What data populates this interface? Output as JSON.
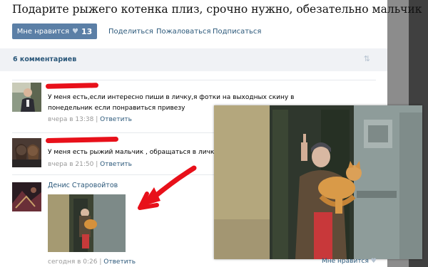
{
  "post": {
    "title": "Подарите рыжего котенка плиз, срочно нужно, обезательно мальчик",
    "like_label": "Мне нравится",
    "like_count": "13",
    "actions": [
      "Поделиться",
      "Пожаловаться",
      "Подписаться"
    ]
  },
  "comments_header": {
    "count_label": "6 комментариев",
    "sort_icon": "sort-arrows-icon"
  },
  "comments": [
    {
      "text": "У меня есть,если интересно пиши в личку,я фотки на выходных скину в понедельник если понравиться привезу",
      "time": "вчера в 13:38",
      "separator": "|",
      "reply": "Ответить"
    },
    {
      "text": "У меня есть рыжий мальчик , обращаться в личку.",
      "time": "вчера в 21:50",
      "separator": "|",
      "reply": "Ответить"
    },
    {
      "author": "Денис Старовойтов",
      "time": "сегодня в 0:26",
      "separator": "|",
      "reply": "Ответить"
    }
  ],
  "photo_popup": {
    "like_label": "Мне нравится"
  },
  "colors": {
    "link": "#2b587a",
    "like_button": "#5b7fa6",
    "redaction": "#e8101a",
    "meta": "#999999"
  }
}
